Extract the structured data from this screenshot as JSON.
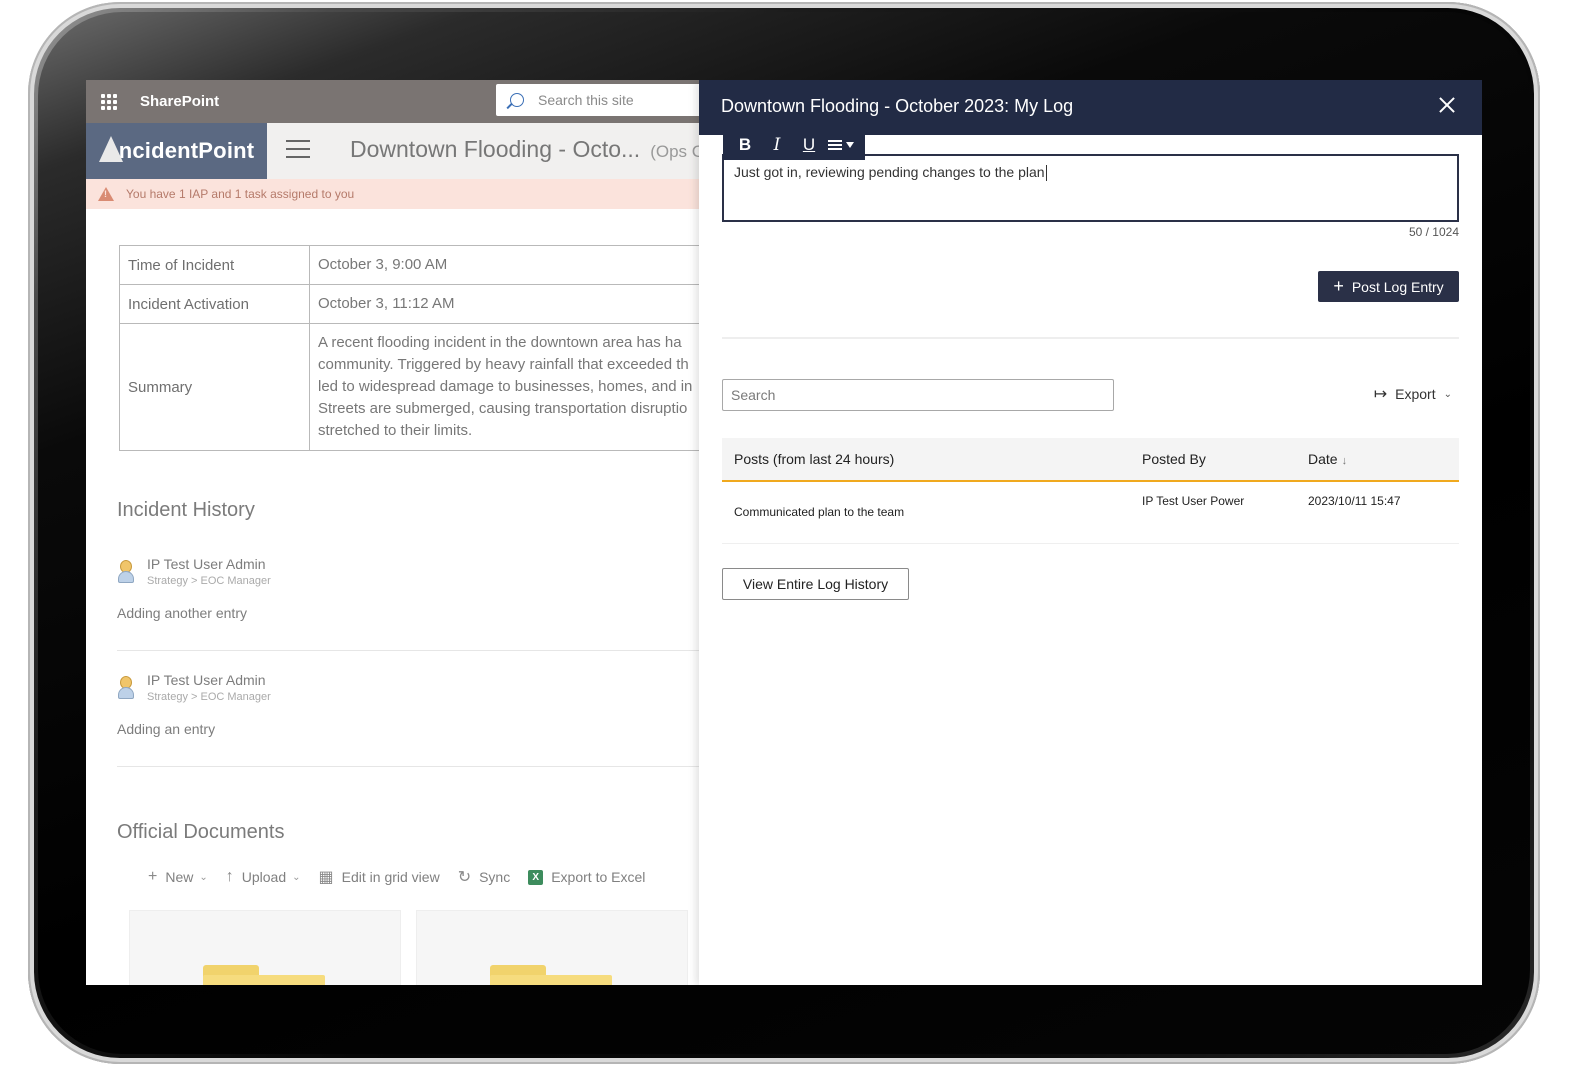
{
  "suitebar": {
    "app_name": "SharePoint",
    "search_placeholder": "Search this site"
  },
  "site": {
    "logo_text": "ncidentPoint",
    "title": "Downtown Flooding - Octo...",
    "title_suffix": "(Ops C"
  },
  "alert": {
    "text": "You have 1 IAP and 1 task assigned to you"
  },
  "incident_table": [
    {
      "label": "Time of Incident",
      "value": "October 3, 9:00 AM"
    },
    {
      "label": "Incident Activation",
      "value": "October 3, 11:12 AM"
    },
    {
      "label": "Summary",
      "value": "A recent flooding incident in the downtown area has ha community. Triggered by heavy rainfall that exceeded th led to widespread damage to businesses, homes, and in Streets are submerged, causing transportation disruptio stretched to their limits."
    }
  ],
  "history": {
    "heading": "Incident History",
    "entries": [
      {
        "user": "IP Test User Admin",
        "role": "Strategy > EOC Manager",
        "text": "Adding another entry"
      },
      {
        "user": "IP Test User Admin",
        "role": "Strategy > EOC Manager",
        "text": "Adding an entry"
      }
    ]
  },
  "documents": {
    "heading": "Official Documents",
    "toolbar": {
      "new": "New",
      "upload": "Upload",
      "edit_grid": "Edit in grid view",
      "sync": "Sync",
      "export_excel": "Export to Excel"
    }
  },
  "panel": {
    "title": "Downtown Flooding - October 2023: My Log",
    "input_value": "Just got in, reviewing pending changes to the plan",
    "char_count": "50 / 1024",
    "post_button": "Post Log Entry",
    "search_placeholder": "Search",
    "export_label": "Export",
    "table": {
      "headers": {
        "posts": "Posts (from last 24 hours)",
        "posted_by": "Posted By",
        "date": "Date"
      },
      "rows": [
        {
          "post": "Communicated plan to the team",
          "posted_by": "IP Test User Power",
          "date": "2023/10/11 15:47"
        }
      ]
    },
    "view_history_button": "View Entire Log History"
  },
  "colors": {
    "panel_header": "#222b45",
    "accent_underline": "#f0a91e",
    "logo_bg": "#5b6982",
    "alert_bg": "#fbe3dc"
  }
}
